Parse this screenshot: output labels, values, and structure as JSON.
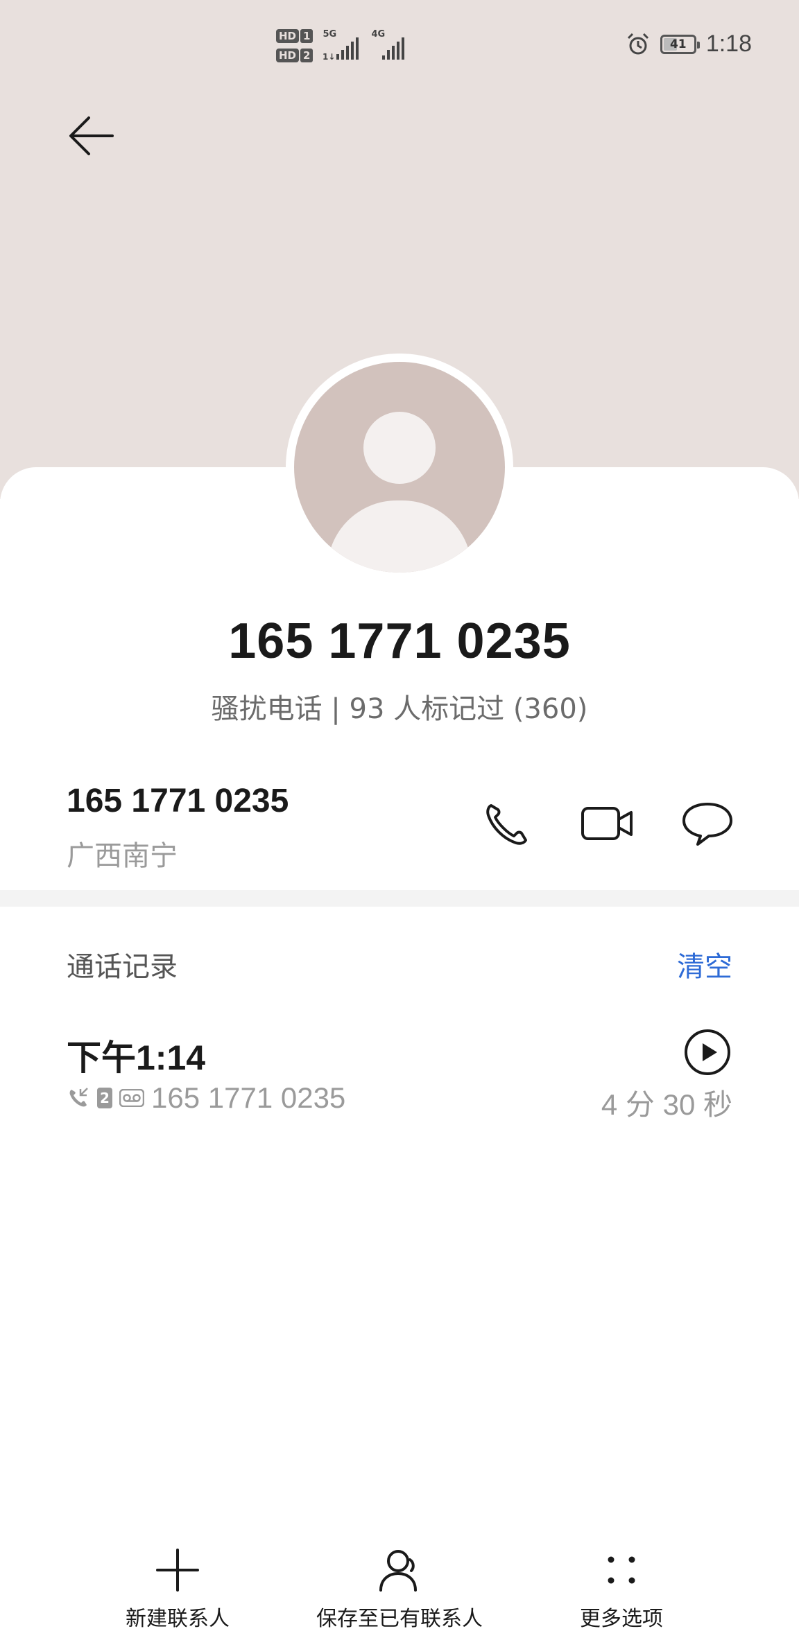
{
  "status_bar": {
    "sim1_badge": "HD",
    "sim1_num": "1",
    "sim2_badge": "HD",
    "sim2_num": "2",
    "network1": "5G",
    "network2": "4G",
    "battery_level": "41",
    "time": "1:18"
  },
  "contact": {
    "display_number": "165 1771 0235",
    "tag": "骚扰电话 | 93 人标记过 (360)"
  },
  "number_row": {
    "number": "165 1771 0235",
    "location": "广西南宁"
  },
  "call_log": {
    "header": "通话记录",
    "clear_label": "清空",
    "records": [
      {
        "time": "下午1:14",
        "sim": "2",
        "number": "165 1771 0235",
        "duration": "4 分 30 秒"
      }
    ]
  },
  "bottom_bar": {
    "new_contact": "新建联系人",
    "save_existing": "保存至已有联系人",
    "more_options": "更多选项"
  },
  "colors": {
    "header_bg": "#e8e0dd",
    "avatar_bg": "#d2c2bd",
    "accent": "#2e6bd6"
  }
}
